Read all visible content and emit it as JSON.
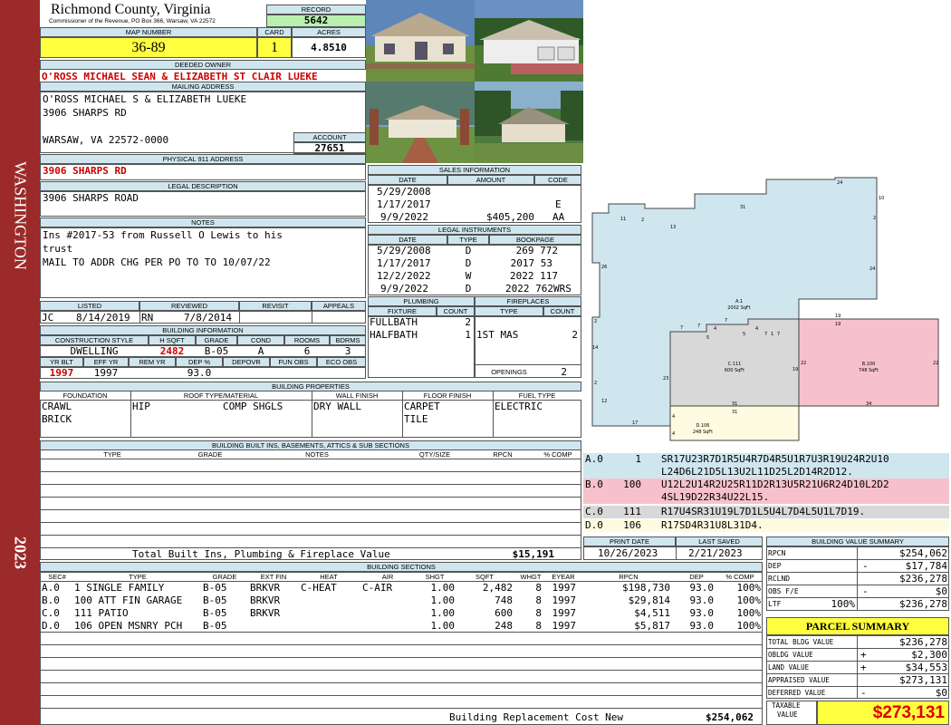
{
  "sidebar": {
    "district": "WASHINGTON",
    "year": "2023"
  },
  "header": {
    "county": "Richmond County, Virginia",
    "commissioner": "Commissioner of the Revenue, PO Box 366, Warsaw, VA 22572",
    "record_label": "RECORD",
    "record": "5642",
    "map_label": "MAP NUMBER",
    "map_number": "36-89",
    "card_label": "CARD",
    "card": "1",
    "acres_label": "ACRES",
    "acres": "4.8510"
  },
  "owner": {
    "deeded_label": "DEEDED OWNER",
    "deeded_owner": "O'ROSS MICHAEL SEAN & ELIZABETH ST CLAIR LUEKE",
    "mailing_label": "MAILING ADDRESS",
    "mailing_line1": "O'ROSS MICHAEL S & ELIZABETH LUEKE",
    "mailing_line2": "3906 SHARPS RD",
    "mailing_line3": "WARSAW, VA 22572-0000",
    "account_label": "ACCOUNT",
    "account": "27651",
    "physical_label": "PHYSICAL 911 ADDRESS",
    "physical": "3906 SHARPS RD",
    "legal_label": "LEGAL DESCRIPTION",
    "legal": "3906 SHARPS ROAD",
    "notes_label": "NOTES",
    "notes_line1": "Ins #2017-53 from Russell O Lewis to his",
    "notes_line2": "trust",
    "notes_line3": "MAIL TO ADDR CHG PER PO TO TO 10/07/22"
  },
  "review": {
    "listed_label": "LISTED",
    "reviewed_label": "REVIEWED",
    "revisit_label": "REVISIT",
    "appeals_label": "APPEALS",
    "listed_by": "JC",
    "listed_date": "8/14/2019",
    "reviewed_by": "RN",
    "reviewed_date": "7/8/2014"
  },
  "building_info": {
    "title": "BUILDING INFORMATION",
    "h_cons": "CONSTRUCTION STYLE",
    "h_hsqft": "H SQFT",
    "h_grade": "GRADE",
    "h_cond": "COND",
    "h_rooms": "ROOMS",
    "h_bdrms": "BDRMS",
    "cons": "DWELLING",
    "hsqft": "2482",
    "grade": "B-05",
    "cond": "A",
    "rooms": "6",
    "bdrms": "3",
    "h_yrblt": "YR BLT",
    "h_effyr": "EFF YR",
    "h_remyr": "REM YR",
    "h_dep": "DEP %",
    "h_depovr": "DEPOVR",
    "h_funobs": "FUN OBS",
    "h_ecoobs": "ECO OBS",
    "yrblt": "1997",
    "effyr": "1997",
    "dep": "93.0"
  },
  "properties": {
    "title": "BUILDING PROPERTIES",
    "h_found": "FOUNDATION",
    "h_roof": "ROOF TYPE/MATERIAL",
    "h_wall": "WALL FINISH",
    "h_floor": "FLOOR FINISH",
    "h_fuel": "FUEL TYPE",
    "found1": "CRAWL",
    "found2": "BRICK",
    "roof_type": "HIP",
    "roof_mat": "COMP SHGLS",
    "wall": "DRY WALL",
    "floor1": "CARPET",
    "floor2": "TILE",
    "fuel": "ELECTRIC"
  },
  "builtins": {
    "title": "BUILDING BUILT INS, BASEMENTS, ATTICS & SUB SECTIONS",
    "h_type": "TYPE",
    "h_grade": "GRADE",
    "h_notes": "NOTES",
    "h_qty": "QTY/SIZE",
    "h_rpcn": "RPCN",
    "h_pcomp": "% COMP",
    "total_label": "Total Built Ins, Plumbing & Fireplace Value",
    "total": "$15,191"
  },
  "sales": {
    "title": "SALES INFORMATION",
    "h_date": "DATE",
    "h_amount": "AMOUNT",
    "h_code": "CODE",
    "rows": [
      {
        "date": "5/29/2008",
        "amount": "",
        "code": ""
      },
      {
        "date": "1/17/2017",
        "amount": "",
        "code": "E"
      },
      {
        "date": "9/9/2022",
        "amount": "$405,200",
        "code": "AA"
      }
    ]
  },
  "legal_instruments": {
    "title": "LEGAL INSTRUMENTS",
    "h_date": "DATE",
    "h_type": "TYPE",
    "h_bookpage": "BOOKPAGE",
    "rows": [
      {
        "date": "5/29/2008",
        "type": "D",
        "book": "269 772"
      },
      {
        "date": "1/17/2017",
        "type": "D",
        "book": "2017 53"
      },
      {
        "date": "12/2/2022",
        "type": "W",
        "book": "2022 117"
      },
      {
        "date": "9/9/2022",
        "type": "D",
        "book": "2022 762WRS"
      }
    ]
  },
  "plumbing": {
    "title": "PLUMBING",
    "h_fixture": "FIXTURE",
    "h_count": "COUNT",
    "rows": [
      {
        "fixture": "FULLBATH",
        "count": "2"
      },
      {
        "fixture": "HALFBATH",
        "count": "1"
      }
    ]
  },
  "fireplaces": {
    "title": "FIREPLACES",
    "h_type": "TYPE",
    "h_count": "COUNT",
    "rows": [
      {
        "type": "1ST MAS",
        "count": "2"
      }
    ],
    "openings_label": "OPENINGS",
    "openings": "2"
  },
  "sketch": {
    "sections": [
      {
        "id": "A.0",
        "code": "1",
        "line1": "SR17U23R7D1R5U4R7D4R5U1R7U3R19U24R2U10",
        "line2": "L24D6L21D5L13U2L11D25L2D14R2D12.",
        "color": "#cfe6ef"
      },
      {
        "id": "B.0",
        "code": "100",
        "line1": "U12L2U14R2U25R11D2R13U5R21U6R24D10L2D2",
        "line2": "4SL19D22R34U22L15.",
        "color": "#f7c1cb"
      },
      {
        "id": "C.0",
        "code": "111",
        "line1": "R17U4SR31U19L7D1L5U4L7D4L5U1L7D19.",
        "line2": "",
        "color": "#d8d8d8"
      },
      {
        "id": "D.0",
        "code": "106",
        "line1": "R17SD4R31U8L31D4.",
        "line2": "",
        "color": "#fffbe0"
      }
    ],
    "labels": {
      "a_name": "A.1",
      "a_area": "2002 SqFt",
      "b_name": "B.100",
      "b_area": "748 SqFt",
      "c_name": "C.111",
      "c_area": "600 SqFt",
      "d_name": "D.106",
      "d_area": "248 SqFt"
    },
    "dims": [
      "24",
      "10",
      "2",
      "31",
      "13",
      "11",
      "2",
      "26",
      "24",
      "19",
      "19",
      "7",
      "7",
      "7",
      "4",
      "4",
      "5",
      "5",
      "7",
      "1",
      "7",
      "2",
      "14",
      "2",
      "23",
      "19",
      "22",
      "22",
      "12",
      "34",
      "31",
      "31",
      "17",
      "4",
      "4"
    ]
  },
  "dates": {
    "print_label": "PRINT DATE",
    "print_date": "10/26/2023",
    "saved_label": "LAST SAVED",
    "saved_date": "2/21/2023"
  },
  "value_summary": {
    "title": "BUILDING VALUE SUMMARY",
    "rows": [
      {
        "label": "RPCN",
        "sign": "",
        "value": "$254,062"
      },
      {
        "label": "DEP",
        "sign": "-",
        "value": "$17,784"
      },
      {
        "label": "RCLND",
        "sign": "",
        "value": "$236,278"
      },
      {
        "label": "OBS F/E",
        "sign": "-",
        "value": "$0"
      },
      {
        "label": "LTF",
        "pct": "100%",
        "sign": "",
        "value": "$236,278"
      }
    ]
  },
  "parcel": {
    "title": "PARCEL SUMMARY",
    "rows": [
      {
        "label": "TOTAL BLDG VALUE",
        "sign": "",
        "value": "$236,278"
      },
      {
        "label": "OBLDG VALUE",
        "sign": "+",
        "value": "$2,300"
      },
      {
        "label": "LAND VALUE",
        "sign": "+",
        "value": "$34,553"
      },
      {
        "label": "APPRAISED VALUE",
        "sign": "",
        "value": "$273,131"
      },
      {
        "label": "DEFERRED VALUE",
        "sign": "-",
        "value": "$0"
      }
    ],
    "taxable_label1": "TAXABLE",
    "taxable_label2": "VALUE",
    "taxable": "$273,131"
  },
  "sections": {
    "title": "BUILDING SECTIONS",
    "headers": [
      "SEC#",
      "TYPE",
      "GRADE",
      "EXT FIN",
      "HEAT",
      "AIR",
      "SHGT",
      "SQFT",
      "WHGT",
      "EYEAR",
      "RPCN",
      "DEP",
      "% COMP"
    ],
    "rows": [
      {
        "sec": "A.0",
        "type": "1 SINGLE FAMILY",
        "grade": "B-05",
        "ext": "BRKVR",
        "heat": "C-HEAT",
        "air": "C-AIR",
        "shgt": "1.00",
        "sqft": "2,482",
        "whgt": "8",
        "eyear": "1997",
        "rpcn": "$198,730",
        "dep": "93.0",
        "pcomp": "100%"
      },
      {
        "sec": "B.0",
        "type": "100 ATT FIN GARAGE",
        "grade": "B-05",
        "ext": "BRKVR",
        "heat": "",
        "air": "",
        "shgt": "1.00",
        "sqft": "748",
        "whgt": "8",
        "eyear": "1997",
        "rpcn": "$29,814",
        "dep": "93.0",
        "pcomp": "100%"
      },
      {
        "sec": "C.0",
        "type": "111 PATIO",
        "grade": "B-05",
        "ext": "BRKVR",
        "heat": "",
        "air": "",
        "shgt": "1.00",
        "sqft": "600",
        "whgt": "8",
        "eyear": "1997",
        "rpcn": "$4,511",
        "dep": "93.0",
        "pcomp": "100%"
      },
      {
        "sec": "D.0",
        "type": "106 OPEN MSNRY PCH",
        "grade": "B-05",
        "ext": "",
        "heat": "",
        "air": "",
        "shgt": "1.00",
        "sqft": "248",
        "whgt": "8",
        "eyear": "1997",
        "rpcn": "$5,817",
        "dep": "93.0",
        "pcomp": "100%"
      }
    ],
    "replacement_label": "Building Replacement Cost New",
    "replacement": "$254,062"
  },
  "photos": [
    {
      "name": "house-photo-front"
    },
    {
      "name": "house-photo-garage"
    },
    {
      "name": "house-photo-driveway"
    },
    {
      "name": "house-photo-side"
    }
  ]
}
